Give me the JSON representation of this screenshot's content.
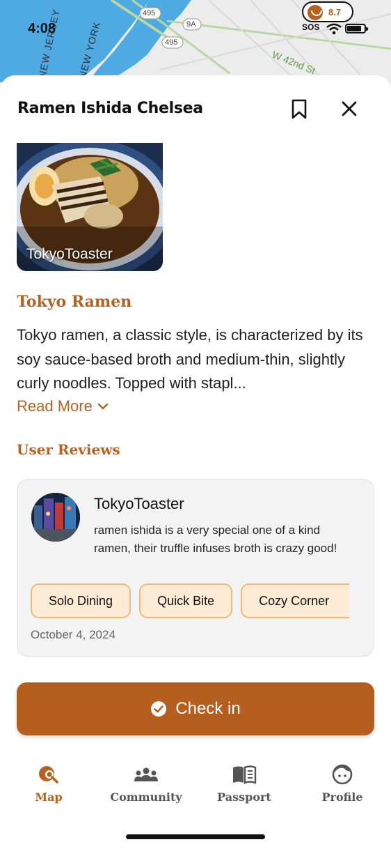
{
  "status_bar": {
    "time": "4:08",
    "score": "8.7",
    "sos": "SOS"
  },
  "map": {
    "labels": [
      "495",
      "9A",
      "495",
      "W 42nd St",
      "NEW JERSEY",
      "NEW YORK"
    ]
  },
  "sheet": {
    "title": "Ramen Ishida Chelsea",
    "photo_credit": "TokyoToaster",
    "style_heading": "Tokyo Ramen",
    "description": "Tokyo ramen, a classic style, is characterized by its soy sauce-based broth and medium-thin, slightly curly noodles. Topped with stapl...",
    "read_more": "Read More"
  },
  "reviews": {
    "heading": "User Reviews",
    "items": [
      {
        "reviewer": "TokyoToaster",
        "text": "ramen ishida is a very special one of a kind ramen, their truffle infuses broth is crazy good!",
        "tags": [
          "Solo Dining",
          "Quick Bite",
          "Cozy Corner"
        ],
        "date": "October 4, 2024"
      }
    ]
  },
  "checkin": {
    "label": "Check in"
  },
  "tabs": [
    {
      "label": "Map",
      "icon": "map-search-icon",
      "active": true
    },
    {
      "label": "Community",
      "icon": "community-icon",
      "active": false
    },
    {
      "label": "Passport",
      "icon": "book-icon",
      "active": false
    },
    {
      "label": "Profile",
      "icon": "profile-face-icon",
      "active": false
    }
  ],
  "colors": {
    "accent": "#b45f20",
    "tag_fill": "#fdebd6",
    "tag_border": "#f0b97c"
  }
}
